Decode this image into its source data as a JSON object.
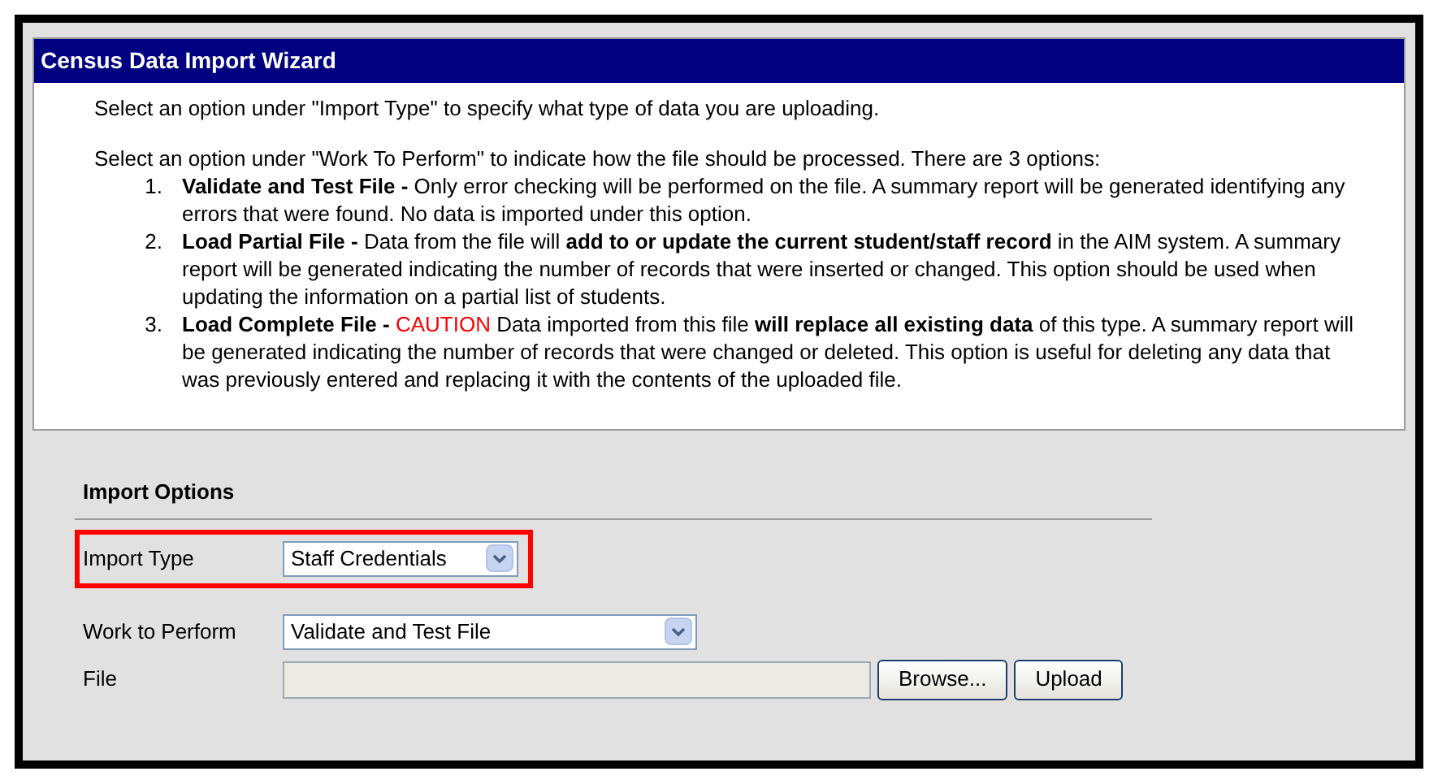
{
  "window": {
    "title": "Census Data Import Wizard"
  },
  "intro": [
    "Select an option under \"Import Type\" to specify what type of data you are uploading.",
    "Select an option under \"Work To Perform\" to indicate how the file should be processed. There are 3 options:"
  ],
  "options": [
    {
      "number": "1.",
      "lead": "**Validate and Test File -** Only error checking will be performed on the file. A summary report will be generated identifying any errors that were found. No data is imported under this option."
    },
    {
      "number": "2.",
      "lead": "**Load Partial File -** Data from the file will **add to or update the current student/staff record** in the AIM system. A summary report will be generated indicating the number of records that were inserted or changed. This option should be used when updating the information on a partial list of students."
    },
    {
      "number": "3.",
      "lead": "**Load Complete File -** ",
      "caution": "CAUTION",
      "text": " Data imported from this file **will replace all existing data** of this type. A summary report will be generated indicating the number of records that were changed or deleted. This option is useful for deleting any data that was previously entered and replacing it with the contents of the uploaded file."
    }
  ],
  "import_options": {
    "heading": "Import Options",
    "import_type": {
      "label": "Import Type",
      "value": "Staff Credentials",
      "highlighted": true
    },
    "work_to_perform": {
      "label": "Work to Perform",
      "value": "Validate and Test File"
    },
    "file": {
      "label": "File",
      "buttons": [
        "Browse...",
        "Upload"
      ]
    }
  }
}
